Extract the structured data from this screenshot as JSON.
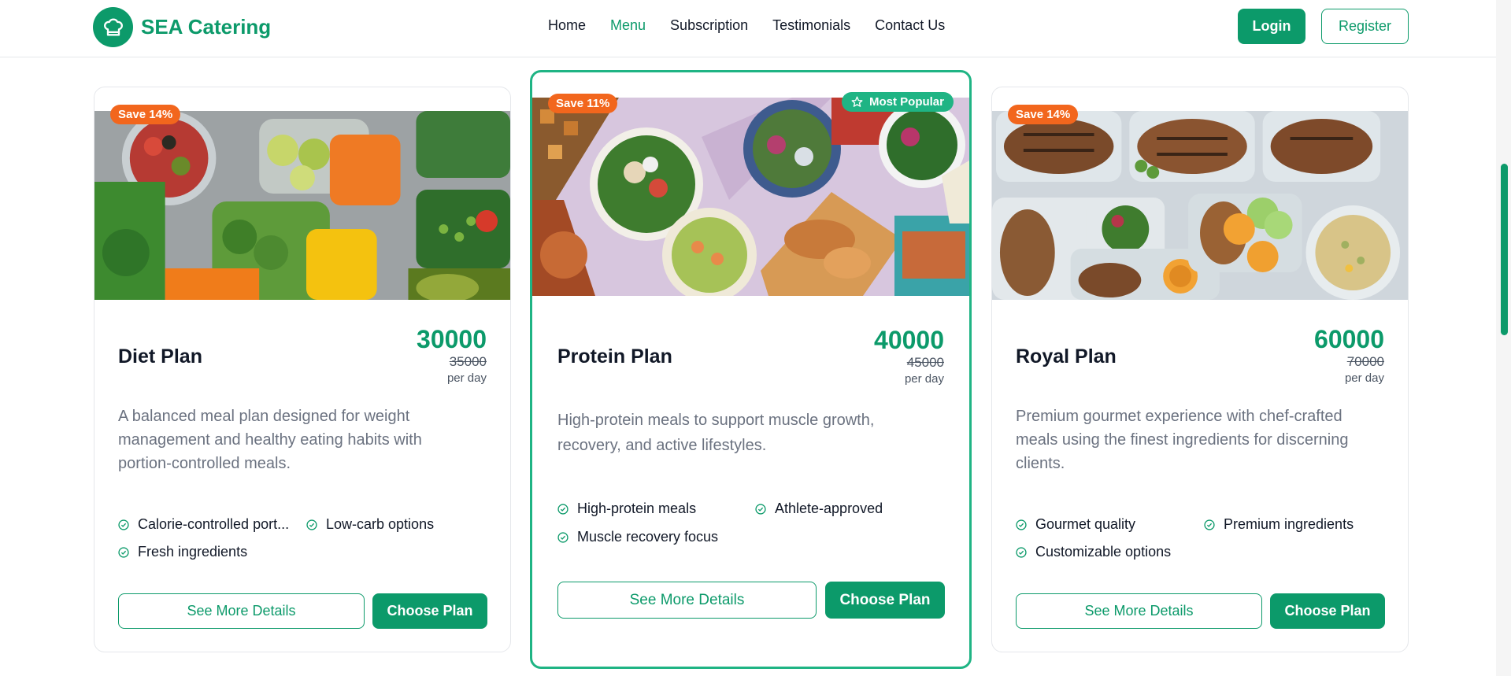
{
  "header": {
    "brand": "SEA Catering",
    "nav": [
      {
        "label": "Home",
        "active": false
      },
      {
        "label": "Menu",
        "active": true
      },
      {
        "label": "Subscription",
        "active": false
      },
      {
        "label": "Testimonials",
        "active": false
      },
      {
        "label": "Contact Us",
        "active": false
      }
    ],
    "login_label": "Login",
    "register_label": "Register"
  },
  "colors": {
    "accent": "#0c9a6a",
    "featured_border": "#1fb484",
    "save_badge": "#f2661d"
  },
  "plans": [
    {
      "save_badge": "Save 14%",
      "title": "Diet Plan",
      "price": "30000",
      "old_price": "35000",
      "unit": "per day",
      "description": "A balanced meal plan designed for weight management and healthy eating habits with portion-controlled meals.",
      "features": [
        "Calorie-controlled port...",
        "Low-carb options",
        "Fresh ingredients"
      ],
      "details_label": "See More Details",
      "choose_label": "Choose Plan"
    },
    {
      "save_badge": "Save 11%",
      "popular_badge": "Most Popular",
      "title": "Protein Plan",
      "price": "40000",
      "old_price": "45000",
      "unit": "per day",
      "description": "High-protein meals to support muscle growth, recovery, and active lifestyles.",
      "features": [
        "High-protein meals",
        "Athlete-approved",
        "Muscle recovery focus"
      ],
      "details_label": "See More Details",
      "choose_label": "Choose Plan"
    },
    {
      "save_badge": "Save 14%",
      "title": "Royal Plan",
      "price": "60000",
      "old_price": "70000",
      "unit": "per day",
      "description": "Premium gourmet experience with chef-crafted meals using the finest ingredients for discerning clients.",
      "features": [
        "Gourmet quality",
        "Premium ingredients",
        "Customizable options"
      ],
      "details_label": "See More Details",
      "choose_label": "Choose Plan"
    }
  ]
}
